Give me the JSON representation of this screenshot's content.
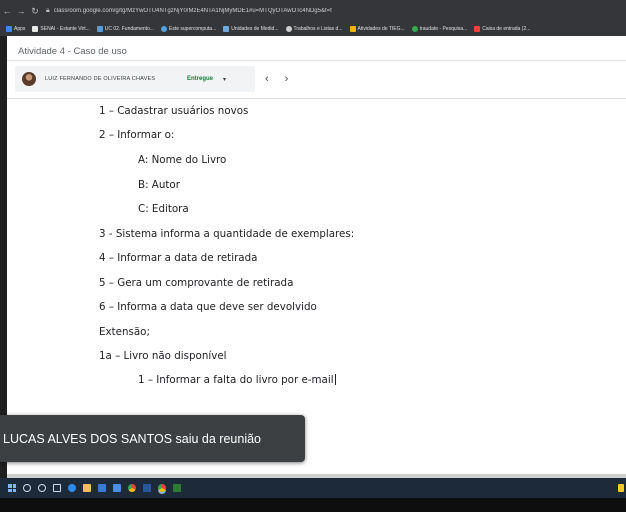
{
  "browser": {
    "url": "classroom.google.com/g/tg/MzYwOTU4NTgzNjY0/MzE4NTA1NjMyMDE1#u=MTQyOTAwOTc4NDg5&t=f",
    "bookmarks": [
      {
        "label": "Apps",
        "color": "#4285f4"
      },
      {
        "label": "SENAI - Estante Virt...",
        "color": "#e8e8e8"
      },
      {
        "label": "UC 02. Fundamento...",
        "color": "#5b9bd5"
      },
      {
        "label": "Este supercomputa...",
        "color": "#4fa3e0"
      },
      {
        "label": "Unidades de Medid...",
        "color": "#6fa8dc"
      },
      {
        "label": "Trabalhos e Listas d...",
        "color": "#cfcfcf"
      },
      {
        "label": "Atividades de TIEG...",
        "color": "#f4b400"
      },
      {
        "label": "traudate - Pesquisa...",
        "color": "#34a853"
      },
      {
        "label": "Caixa de entrada (2...",
        "color": "#ea4335"
      }
    ]
  },
  "header": {
    "assignment_title": "Atividade 4 - Caso de uso",
    "student_name": "LUIZ FERNANDO DE OLIVEIRA CHAVES",
    "status": "Entregue",
    "caret": "▾",
    "prev": "‹",
    "next": "›"
  },
  "document": {
    "lines": [
      "1 – Cadastrar usuários novos",
      "2 – Informar o:",
      "A: Nome do Livro",
      "B:  Autor",
      "C:  Editora",
      "3 - Sistema informa a quantidade de exemplares:",
      "4 – Informar a data de retirada",
      "5 –  Gera um comprovante de retirada",
      "6 – Informa a data que deve ser devolvido",
      "Extensão;",
      "1a – Livro não disponível",
      "1 – Informar a falta do livro por e-mail"
    ]
  },
  "toast": {
    "message": "LUCAS ALVES DOS SANTOS saiu da reunião"
  }
}
